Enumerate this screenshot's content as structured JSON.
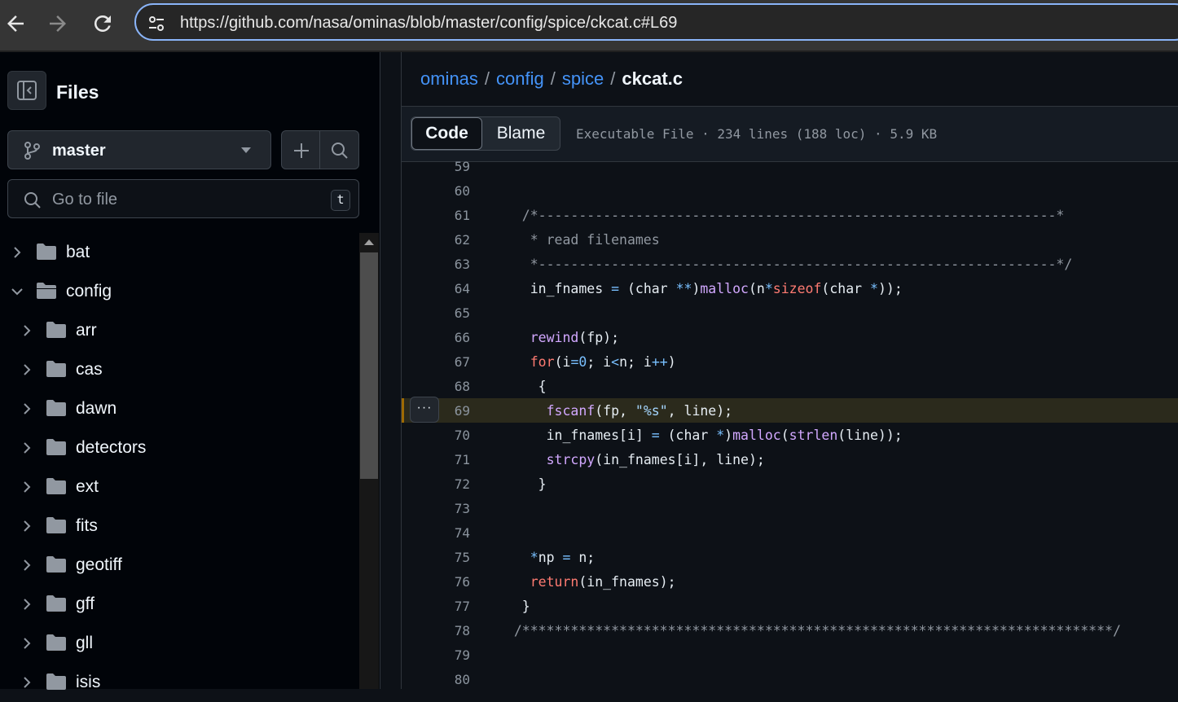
{
  "browser": {
    "url": "https://github.com/nasa/ominas/blob/master/config/spice/ckcat.c#L69",
    "icons": [
      "back-arrow-icon",
      "forward-arrow-icon",
      "reload-icon",
      "site-settings-icon"
    ]
  },
  "sidebar": {
    "title": "Files",
    "branch": "master",
    "goto_placeholder": "Go to file",
    "goto_shortcut": "t",
    "tree": [
      {
        "label": "bat",
        "depth": 0,
        "expanded": false
      },
      {
        "label": "config",
        "depth": 0,
        "expanded": true
      },
      {
        "label": "arr",
        "depth": 1,
        "expanded": false
      },
      {
        "label": "cas",
        "depth": 1,
        "expanded": false
      },
      {
        "label": "dawn",
        "depth": 1,
        "expanded": false
      },
      {
        "label": "detectors",
        "depth": 1,
        "expanded": false
      },
      {
        "label": "ext",
        "depth": 1,
        "expanded": false
      },
      {
        "label": "fits",
        "depth": 1,
        "expanded": false
      },
      {
        "label": "geotiff",
        "depth": 1,
        "expanded": false
      },
      {
        "label": "gff",
        "depth": 1,
        "expanded": false
      },
      {
        "label": "gll",
        "depth": 1,
        "expanded": false
      },
      {
        "label": "isis",
        "depth": 1,
        "expanded": false
      }
    ]
  },
  "breadcrumb": {
    "parts": [
      "ominas",
      "config",
      "spice"
    ],
    "separator": "/",
    "current": "ckcat.c"
  },
  "toolbar": {
    "code_label": "Code",
    "blame_label": "Blame",
    "file_info": "Executable File · 234 lines (188 loc) · 5.9 KB"
  },
  "code": {
    "highlighted_line": 69,
    "more_button": "···",
    "lines": [
      {
        "n": "59",
        "tokens": []
      },
      {
        "n": "60",
        "tokens": []
      },
      {
        "n": "61",
        "tokens": [
          [
            "c-com",
            "   /*----------------------------------------------------------------*"
          ]
        ]
      },
      {
        "n": "62",
        "tokens": [
          [
            "c-com",
            "    * read filenames"
          ]
        ]
      },
      {
        "n": "63",
        "tokens": [
          [
            "c-com",
            "    *----------------------------------------------------------------*/"
          ]
        ]
      },
      {
        "n": "64",
        "tokens": [
          [
            "",
            "    in_fnames "
          ],
          [
            "c-op",
            "="
          ],
          [
            "",
            " (char "
          ],
          [
            "c-op",
            "**"
          ],
          [
            "",
            ")"
          ],
          [
            "c-fn",
            "malloc"
          ],
          [
            "",
            "(n"
          ],
          [
            "c-op",
            "*"
          ],
          [
            "c-kw",
            "sizeof"
          ],
          [
            "",
            "(char "
          ],
          [
            "c-op",
            "*"
          ],
          [
            "",
            "));"
          ]
        ]
      },
      {
        "n": "65",
        "tokens": []
      },
      {
        "n": "66",
        "tokens": [
          [
            "",
            "    "
          ],
          [
            "c-fn",
            "rewind"
          ],
          [
            "",
            "(fp);"
          ]
        ]
      },
      {
        "n": "67",
        "tokens": [
          [
            "",
            "    "
          ],
          [
            "c-kw",
            "for"
          ],
          [
            "",
            "(i"
          ],
          [
            "c-op",
            "="
          ],
          [
            "c-op",
            "0"
          ],
          [
            "",
            "; i"
          ],
          [
            "c-op",
            "<"
          ],
          [
            "",
            "n; i"
          ],
          [
            "c-op",
            "++"
          ],
          [
            "",
            ")"
          ]
        ]
      },
      {
        "n": "68",
        "tokens": [
          [
            "",
            "     {"
          ]
        ]
      },
      {
        "n": "69",
        "tokens": [
          [
            "",
            "      "
          ],
          [
            "c-fn",
            "fscanf"
          ],
          [
            "",
            "(fp, "
          ],
          [
            "c-str",
            "\"%s\""
          ],
          [
            "",
            ", line);"
          ]
        ]
      },
      {
        "n": "70",
        "tokens": [
          [
            "",
            "      in_fnames[i] "
          ],
          [
            "c-op",
            "="
          ],
          [
            "",
            " (char "
          ],
          [
            "c-op",
            "*"
          ],
          [
            "",
            ")"
          ],
          [
            "c-fn",
            "malloc"
          ],
          [
            "",
            "("
          ],
          [
            "c-fn",
            "strlen"
          ],
          [
            "",
            "(line));"
          ]
        ]
      },
      {
        "n": "71",
        "tokens": [
          [
            "",
            "      "
          ],
          [
            "c-fn",
            "strcpy"
          ],
          [
            "",
            "(in_fnames[i], line);"
          ]
        ]
      },
      {
        "n": "72",
        "tokens": [
          [
            "",
            "     }"
          ]
        ]
      },
      {
        "n": "73",
        "tokens": []
      },
      {
        "n": "74",
        "tokens": []
      },
      {
        "n": "75",
        "tokens": [
          [
            "",
            "    "
          ],
          [
            "c-op",
            "*"
          ],
          [
            "",
            "np "
          ],
          [
            "c-op",
            "="
          ],
          [
            "",
            " n;"
          ]
        ]
      },
      {
        "n": "76",
        "tokens": [
          [
            "",
            "    "
          ],
          [
            "c-kw",
            "return"
          ],
          [
            "",
            "(in_fnames);"
          ]
        ]
      },
      {
        "n": "77",
        "tokens": [
          [
            "",
            "   }"
          ]
        ]
      },
      {
        "n": "78",
        "tokens": [
          [
            "c-com",
            "  /*************************************************************************/"
          ]
        ]
      },
      {
        "n": "79",
        "tokens": []
      },
      {
        "n": "80",
        "tokens": []
      }
    ]
  },
  "colors": {
    "accent_link": "#4493f8",
    "focus_ring": "#8ab4f8",
    "highlight_bar": "#9e6a03"
  }
}
